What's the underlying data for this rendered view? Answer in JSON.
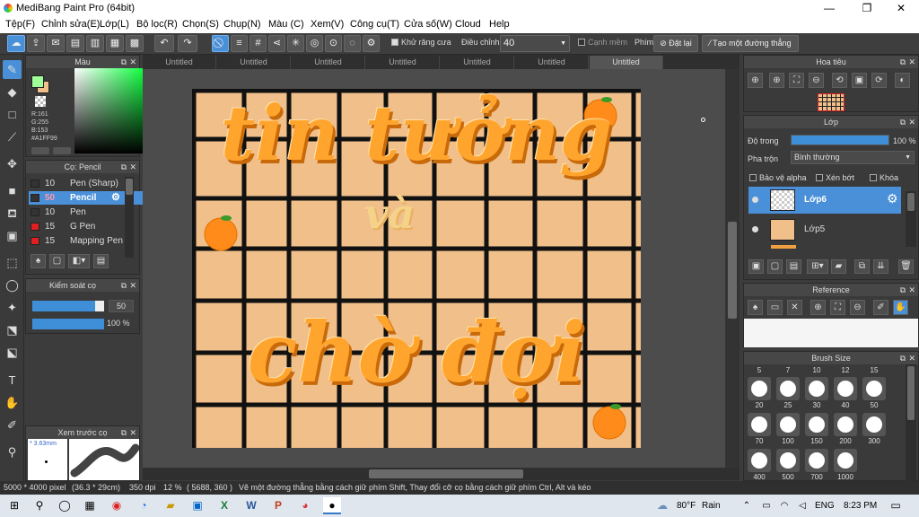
{
  "window": {
    "title": "MediBang Paint Pro (64bit)",
    "minimize": "—",
    "maximize": "❐",
    "close": "✕"
  },
  "menu": [
    "Tệp(F)",
    "Chỉnh sửa(E)",
    "Lớp(L)",
    "Bộ lọc(R)",
    "Chọn(S)",
    "Chụp(N)",
    "Màu (C)",
    "Xem(V)",
    "Công cụ(T)",
    "Cửa số(W)",
    "Cloud",
    "Help"
  ],
  "toolbar": {
    "antialias_label": "Khử răng cưa",
    "adjust_label": "Điều chỉnh",
    "adjust_value": "40",
    "soft_edge_label": "Cạnh mềm",
    "key_label": "Phím",
    "reset_label": "Đặt lại",
    "line_label": "Tạo một đường thẳng"
  },
  "color_panel": {
    "title": "Màu",
    "r": "R:161",
    "g": "G:255",
    "b": "B:153",
    "hex": "#A1FF99",
    "fg_color": "#A1FF99",
    "bg_color": "#f0bf8a"
  },
  "brush_panel": {
    "title": "Cọ: Pencil",
    "brushes": [
      {
        "size": "10",
        "name": "Pen (Sharp)",
        "color": "#333333"
      },
      {
        "size": "50",
        "name": "Pencil",
        "color": "#333333"
      },
      {
        "size": "10",
        "name": "Pen",
        "color": "#333333"
      },
      {
        "size": "15",
        "name": "G Pen",
        "color": "#e02020"
      },
      {
        "size": "15",
        "name": "Mapping Pen",
        "color": "#e02020"
      }
    ]
  },
  "brush_control": {
    "title": "Kiểm soát cọ",
    "size": "50",
    "opacity": "100 %",
    "size_fraction": 0.87,
    "opacity_fraction": 1.0
  },
  "preview_panel": {
    "title": "Xem trước cọ",
    "size_label": "3.63mm"
  },
  "tabs": [
    "Untitled",
    "Untitled",
    "Untitled",
    "Untitled",
    "Untitled",
    "Untitled",
    "Untitled"
  ],
  "artwork": {
    "line1": "tin tưởng",
    "line2": "và",
    "line3": "chờ đợi"
  },
  "navigator": {
    "title": "Hoa tiêu"
  },
  "layer_panel": {
    "title": "Lớp",
    "opacity_label": "Độ trong",
    "opacity_value": "100 %",
    "blend_label": "Pha trộn",
    "blend_value": "Bình thường",
    "protect_alpha": "Bảo vệ alpha",
    "clipping": "Xén bớt",
    "lock": "Khóa",
    "layers": [
      {
        "name": "Lớp6"
      },
      {
        "name": "Lớp5"
      }
    ]
  },
  "reference_panel": {
    "title": "Reference"
  },
  "brush_size_panel": {
    "title": "Brush Size",
    "header": [
      "5",
      "7",
      "10",
      "12",
      "15"
    ],
    "row1": [
      "20",
      "25",
      "30",
      "40",
      "50"
    ],
    "row2": [
      "70",
      "100",
      "150",
      "200",
      "300"
    ],
    "row3": [
      "400",
      "500",
      "700",
      "1000"
    ]
  },
  "status": {
    "dims": "5000 * 4000 pixel",
    "cm": "(36.3 * 29cm)",
    "dpi": "350 dpi",
    "zoom": "12 %",
    "coords": "( 5688, 360 )",
    "hint": "Vẽ một đường thẳng bằng cách giữ phím Shift, Thay đổi cỡ cọ bằng cách giữ phím Ctrl, Alt và kéo"
  },
  "taskbar": {
    "weather": "80°F",
    "weather_desc": "Rain",
    "lang": "ENG",
    "time": "8:23 PM"
  }
}
